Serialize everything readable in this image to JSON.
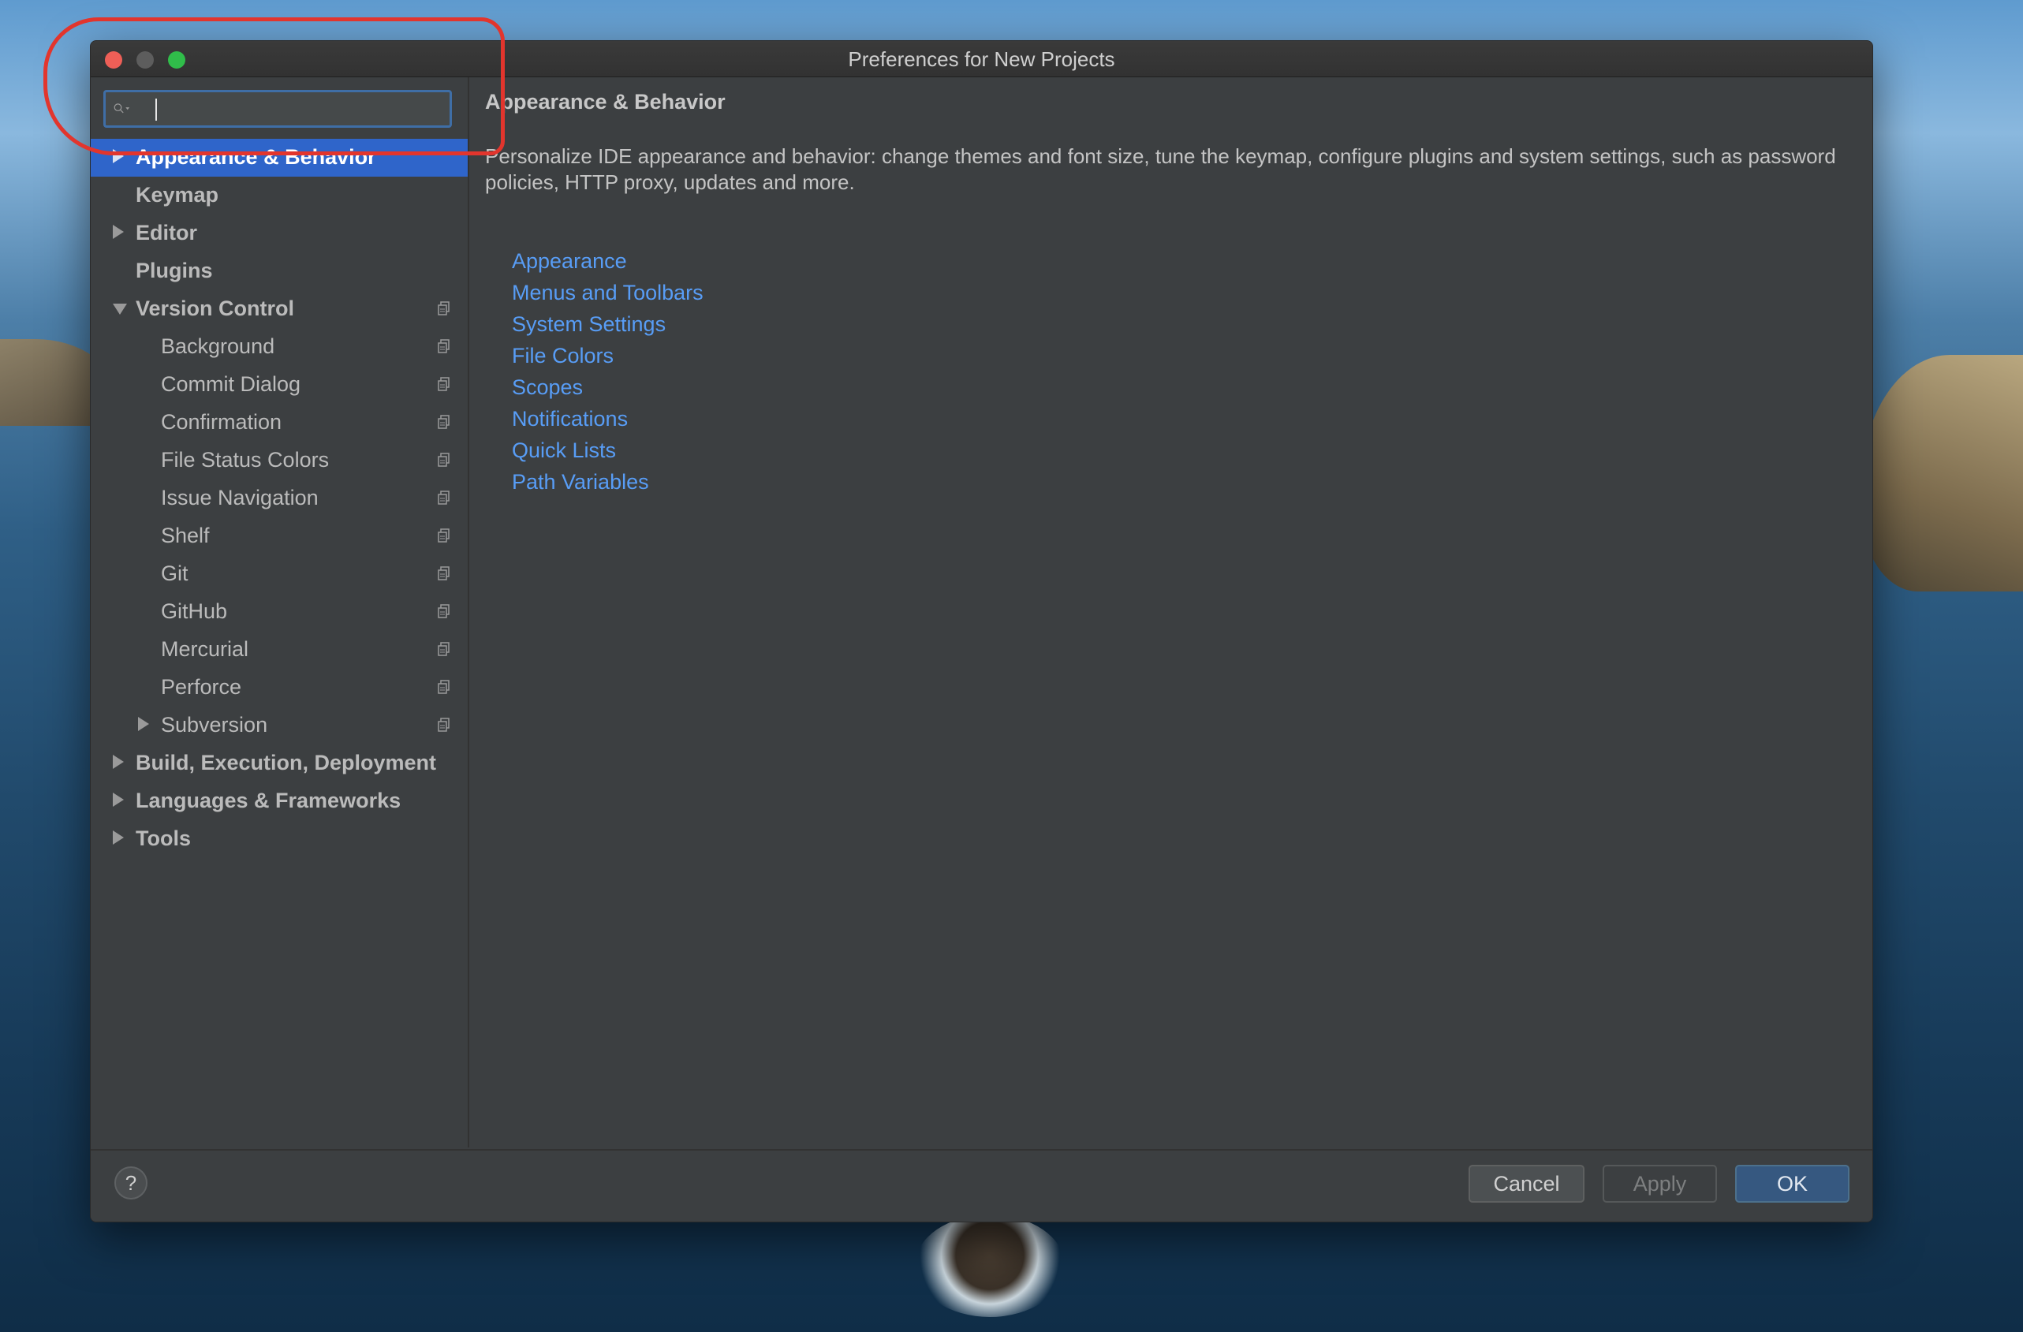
{
  "window": {
    "title": "Preferences for New Projects"
  },
  "search": {
    "value": "",
    "placeholder": ""
  },
  "sidebar": {
    "items": [
      {
        "label": "Appearance & Behavior",
        "arrow": "right",
        "bold": true,
        "selected": true,
        "icon": ""
      },
      {
        "label": "Keymap",
        "arrow": "",
        "bold": true,
        "icon": ""
      },
      {
        "label": "Editor",
        "arrow": "right",
        "bold": true,
        "icon": ""
      },
      {
        "label": "Plugins",
        "arrow": "",
        "bold": true,
        "icon": ""
      },
      {
        "label": "Version Control",
        "arrow": "down",
        "bold": true,
        "icon": "copy-icon"
      },
      {
        "label": "Background",
        "arrow": "",
        "bold": false,
        "icon": "copy-icon"
      },
      {
        "label": "Commit Dialog",
        "arrow": "",
        "bold": false,
        "icon": "copy-icon"
      },
      {
        "label": "Confirmation",
        "arrow": "",
        "bold": false,
        "icon": "copy-icon"
      },
      {
        "label": "File Status Colors",
        "arrow": "",
        "bold": false,
        "icon": "copy-icon"
      },
      {
        "label": "Issue Navigation",
        "arrow": "",
        "bold": false,
        "icon": "copy-icon"
      },
      {
        "label": "Shelf",
        "arrow": "",
        "bold": false,
        "icon": "copy-icon"
      },
      {
        "label": "Git",
        "arrow": "",
        "bold": false,
        "icon": "copy-icon"
      },
      {
        "label": "GitHub",
        "arrow": "",
        "bold": false,
        "icon": "copy-icon"
      },
      {
        "label": "Mercurial",
        "arrow": "",
        "bold": false,
        "icon": "copy-icon"
      },
      {
        "label": "Perforce",
        "arrow": "",
        "bold": false,
        "icon": "copy-icon"
      },
      {
        "label": "Subversion",
        "arrow": "right",
        "bold": false,
        "icon": "copy-icon"
      },
      {
        "label": "Build, Execution, Deployment",
        "arrow": "right",
        "bold": true,
        "icon": ""
      },
      {
        "label": "Languages & Frameworks",
        "arrow": "right",
        "bold": true,
        "icon": ""
      },
      {
        "label": "Tools",
        "arrow": "right",
        "bold": true,
        "icon": ""
      }
    ]
  },
  "content": {
    "title": "Appearance & Behavior",
    "description": "Personalize IDE appearance and behavior: change themes and font size, tune the keymap, configure plugins and system settings, such as password policies, HTTP proxy, updates and more.",
    "links": [
      "Appearance",
      "Menus and Toolbars",
      "System Settings",
      "File Colors",
      "Scopes",
      "Notifications",
      "Quick Lists",
      "Path Variables"
    ]
  },
  "footer": {
    "help_label": "?",
    "cancel_label": "Cancel",
    "apply_label": "Apply",
    "ok_label": "OK"
  },
  "colors": {
    "selection": "#2f65ca",
    "link": "#589df6",
    "annotation": "#e2352d"
  }
}
